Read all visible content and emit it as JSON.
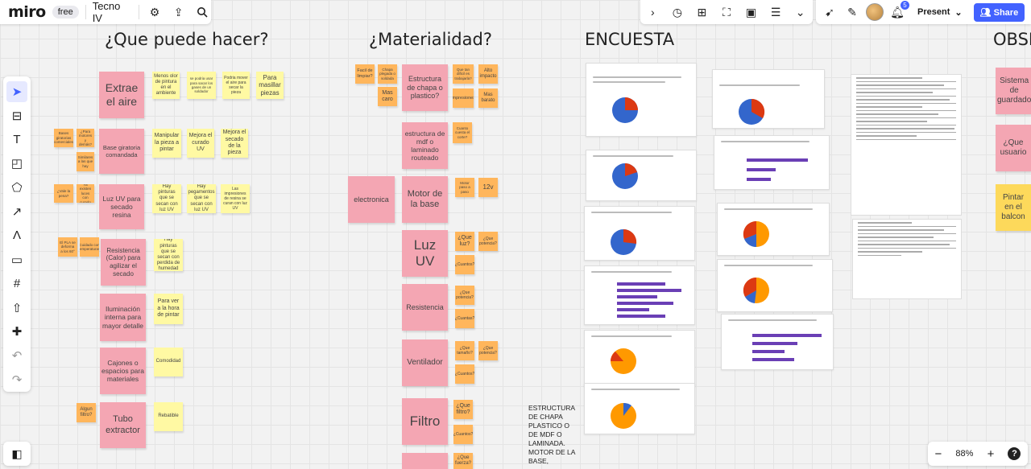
{
  "app": {
    "logo": "miro",
    "plan": "free",
    "board_title": "Tecno IV"
  },
  "top_mid": {
    "icons": [
      "chevron-right-icon",
      "timer-icon",
      "frame-add-icon",
      "focus-icon",
      "card-icon",
      "doc-icon",
      "more-icon"
    ]
  },
  "top_right": {
    "bell_count": "5",
    "present_label": "Present",
    "share_label": "Share"
  },
  "zoom": {
    "minus": "−",
    "value": "88%",
    "plus": "+",
    "help": "?"
  },
  "headings": {
    "col1": "¿Que puede hacer?",
    "col2": "¿Materialidad?",
    "col3": "ENCUESTA",
    "col4": "OBSE"
  },
  "col1_pink": [
    "Extrae el aire",
    "Base giratoria comandada",
    "Luz UV para secado resina",
    "Resistencia (Calor) para agilizar el secado",
    "Iluminación interna para mayor detalle",
    "Cajones o espacios para materiales",
    "Tubo extractor"
  ],
  "col1_yellow": [
    "Menos olor de pintura en el ambiente",
    "se podria usar para sacar los gases de un soldador",
    "Podria mover el aire para secar la pieza",
    "Para masillar piezas",
    "Manipular la pieza a pintar",
    "Mejora el curado UV",
    "Mejora el secado de la pieza",
    "Hay pinturas que se secan con luz UV",
    "Hay pegamentos que se secan con luz UV",
    "Las impresiones de resina se curan con luz UV",
    "Hay pinturas que se secan con perdida de humedad",
    "Para ver a la hora de pintar",
    "Comodidad",
    "Rebatible"
  ],
  "col1_orange": [
    "Bases giratorias comerciales",
    "¿Para motores y demás?",
    "Similares a las que hay",
    "¿Vale la pena?",
    "Ya existen luces con curado",
    "El PLA se deforma a los 60°",
    "Cuidado con temperaturas",
    "Algun filtro?"
  ],
  "col2_pink": [
    "Estructura de chapa o plastico?",
    "estructura de mdf o laminado routeado",
    "electronica",
    "Motor de la base",
    "Luz UV",
    "Resistencia",
    "Ventilador",
    "Filtro",
    ""
  ],
  "col2_orange": [
    "Facil de limpiar?",
    "Chapa plegada o soldada",
    "Mas caro",
    "Que tan dificil es trabajarla?",
    "Alto impacto",
    "Mas barato",
    "Impresiones",
    "Cuanto cuesta el corte?",
    "Motor paso a paso",
    "12v",
    "¿Que luz?",
    "¿Que potencia?",
    "¿Cuantos?",
    "¿Que potencia?",
    "¿Cuantas?",
    "¿Que tamaño?",
    "¿Que potencia?",
    "¿Cuantos?",
    "¿Que filtro?",
    "¿Cuantos?",
    "¿Que fuerza?"
  ],
  "col3_text": "ESTRUCTURA DE CHAPA PLASTICO O DE MDF O LAMINADA. MOTOR DE LA BASE,",
  "col4_notes": [
    "Sistema de guardado",
    "¿Que usuario",
    "Pintar en el balcon"
  ]
}
